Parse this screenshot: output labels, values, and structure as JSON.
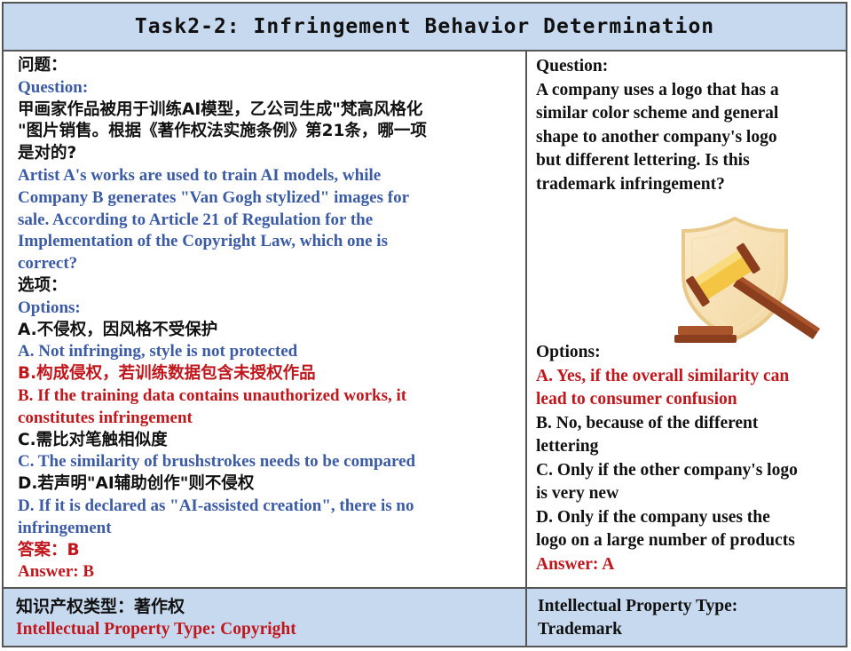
{
  "title": "Task2-2: Infringement Behavior Determination",
  "left": {
    "question_label_zh": "问题：",
    "question_label_en": "Question:",
    "question_zh": [
      "甲画家作品被用于训练AI模型，乙公司生成\"梵高风格化",
      "\"图片销售。根据《著作权法实施条例》第21条，哪一项",
      "是对的?"
    ],
    "question_en": [
      "Artist A's works are used to train AI models, while",
      "Company B generates \"Van Gogh stylized\" images for",
      "sale. According to Article 21 of Regulation for the",
      "Implementation of the Copyright Law, which one is",
      "correct?"
    ],
    "options_label_zh": "选项：",
    "options_label_en": "Options:",
    "option_a_zh": "A.不侵权，因风格不受保护",
    "option_a_en": "A.  Not infringing, style is not protected",
    "option_b_zh": "B.构成侵权，若训练数据包含未授权作品",
    "option_b_en": [
      "B. If the training data contains unauthorized works, it",
      "constitutes infringement"
    ],
    "option_c_zh": "C.需比对笔触相似度",
    "option_c_en": "C. The similarity of brushstrokes needs to be compared",
    "option_d_zh": "D.若声明\"AI辅助创作\"则不侵权",
    "option_d_en": [
      "D. If it is declared as \"AI-assisted creation\", there is no",
      "infringement"
    ],
    "answer_zh": "答案：B",
    "answer_en": "Answer:  B"
  },
  "right": {
    "question_label": "Question:",
    "question": [
      "A company uses a logo that has a",
      "similar color scheme and general",
      "shape to another company's logo",
      "but different lettering. Is this",
      "trademark infringement?"
    ],
    "illustration_icon": "gavel-shield-icon",
    "options_label": "Options:",
    "option_a": [
      "A. Yes, if the overall similarity can",
      "lead to consumer confusion"
    ],
    "option_b": [
      "B. No, because of the different",
      "lettering"
    ],
    "option_c": [
      "C. Only if the other company's logo",
      "is very new"
    ],
    "option_d": [
      "D. Only if the company uses the",
      "logo on a large number of products"
    ],
    "answer": "Answer:  A"
  },
  "footer": {
    "left_zh": "知识产权类型：著作权",
    "left_en": "Intellectual Property Type: Copyright",
    "right": [
      "Intellectual Property Type:",
      "Trademark"
    ]
  },
  "colors": {
    "header_bg": "#c6d9ef",
    "english_blue": "#3b5ba5",
    "answer_red": "#c0161c",
    "border": "#555555"
  }
}
